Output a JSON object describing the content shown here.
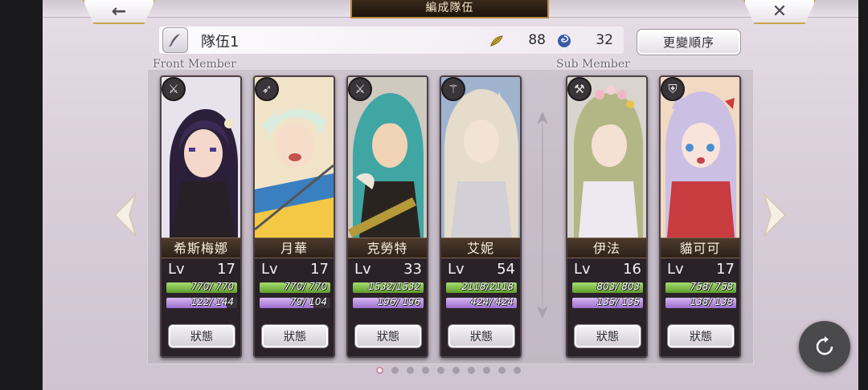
{
  "header": {
    "title": "編成隊伍",
    "back_icon": "←",
    "close_icon": "✕"
  },
  "team": {
    "name": "隊伍1",
    "stat1_value": "88",
    "stat2_value": "32",
    "order_button": "更變順序"
  },
  "sections": {
    "front": "Front Member",
    "sub": "Sub Member"
  },
  "members": [
    {
      "name": "希斯梅娜",
      "lv_label": "Lv",
      "lv": "17",
      "hp": "770/ 770",
      "mp": "122/ 144",
      "hp_ratio": 1.0,
      "mp_ratio": 0.847,
      "role": "sword-icon",
      "status": "狀態"
    },
    {
      "name": "月華",
      "lv_label": "Lv",
      "lv": "17",
      "hp": "770/ 770",
      "mp": "79/ 104",
      "hp_ratio": 1.0,
      "mp_ratio": 0.76,
      "role": "arrow-icon",
      "status": "狀態"
    },
    {
      "name": "克勞特",
      "lv_label": "Lv",
      "lv": "33",
      "hp": "1532/1532",
      "mp": "196/ 196",
      "hp_ratio": 1.0,
      "mp_ratio": 1.0,
      "role": "sword-icon",
      "status": "狀態"
    },
    {
      "name": "艾妮",
      "lv_label": "Lv",
      "lv": "54",
      "hp": "2118/2118",
      "mp": "424/ 424",
      "hp_ratio": 1.0,
      "mp_ratio": 1.0,
      "role": "staff-icon",
      "status": "狀態"
    },
    {
      "name": "伊法",
      "lv_label": "Lv",
      "lv": "16",
      "hp": "803/ 803",
      "mp": "135/ 135",
      "hp_ratio": 1.0,
      "mp_ratio": 1.0,
      "role": "axe-icon",
      "status": "狀態"
    },
    {
      "name": "貓可可",
      "lv_label": "Lv",
      "lv": "17",
      "hp": "758/ 758",
      "mp": "138/ 138",
      "hp_ratio": 1.0,
      "mp_ratio": 1.0,
      "role": "shield-icon",
      "status": "狀態"
    }
  ],
  "pagination": {
    "total": 10,
    "active": 0
  },
  "colors": {
    "hp": "#7cc04a",
    "mp": "#b48fe0",
    "gold_border": "#c9a54d"
  }
}
